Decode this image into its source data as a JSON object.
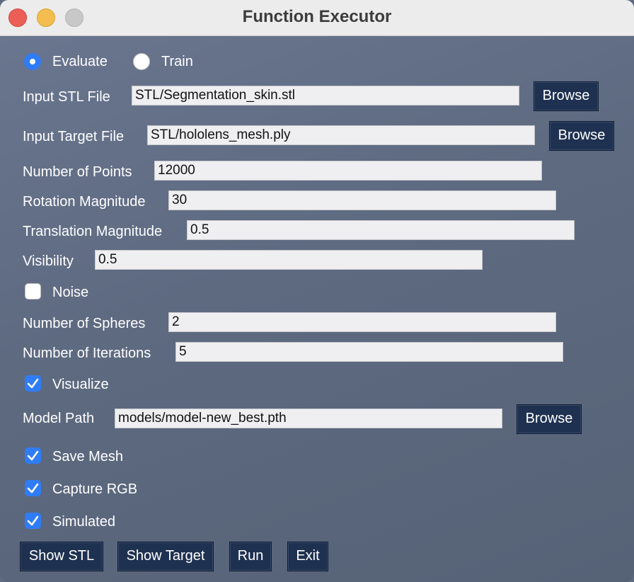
{
  "window": {
    "title": "Function Executor"
  },
  "mode": {
    "options": [
      "Evaluate",
      "Train"
    ],
    "selected": "Evaluate"
  },
  "fields": {
    "input_stl": {
      "label": "Input STL File",
      "value": "STL/Segmentation_skin.stl"
    },
    "input_target": {
      "label": "Input Target File",
      "value": "STL/hololens_mesh.ply"
    },
    "num_points": {
      "label": "Number of Points",
      "value": "12000"
    },
    "rotation_magnitude": {
      "label": "Rotation Magnitude",
      "value": "30"
    },
    "translation_magnitude": {
      "label": "Translation Magnitude",
      "value": "0.5"
    },
    "visibility": {
      "label": "Visibility",
      "value": "0.5"
    },
    "num_spheres": {
      "label": "Number of Spheres",
      "value": "2"
    },
    "num_iterations": {
      "label": "Number of Iterations",
      "value": "5"
    },
    "model_path": {
      "label": "Model Path",
      "value": "models/model-new_best.pth"
    }
  },
  "checkboxes": {
    "noise": {
      "label": "Noise",
      "checked": false
    },
    "visualize": {
      "label": "Visualize",
      "checked": true
    },
    "save_mesh": {
      "label": "Save Mesh",
      "checked": true
    },
    "capture_rgb": {
      "label": "Capture RGB",
      "checked": true
    },
    "simulated": {
      "label": "Simulated",
      "checked": true
    }
  },
  "buttons": {
    "browse": "Browse",
    "show_stl": "Show STL",
    "show_target": "Show Target",
    "run": "Run",
    "exit": "Exit"
  },
  "colors": {
    "accent": "#2f7cf6",
    "button_bg": "#1f3150",
    "window_bg": "#5f6b80"
  }
}
